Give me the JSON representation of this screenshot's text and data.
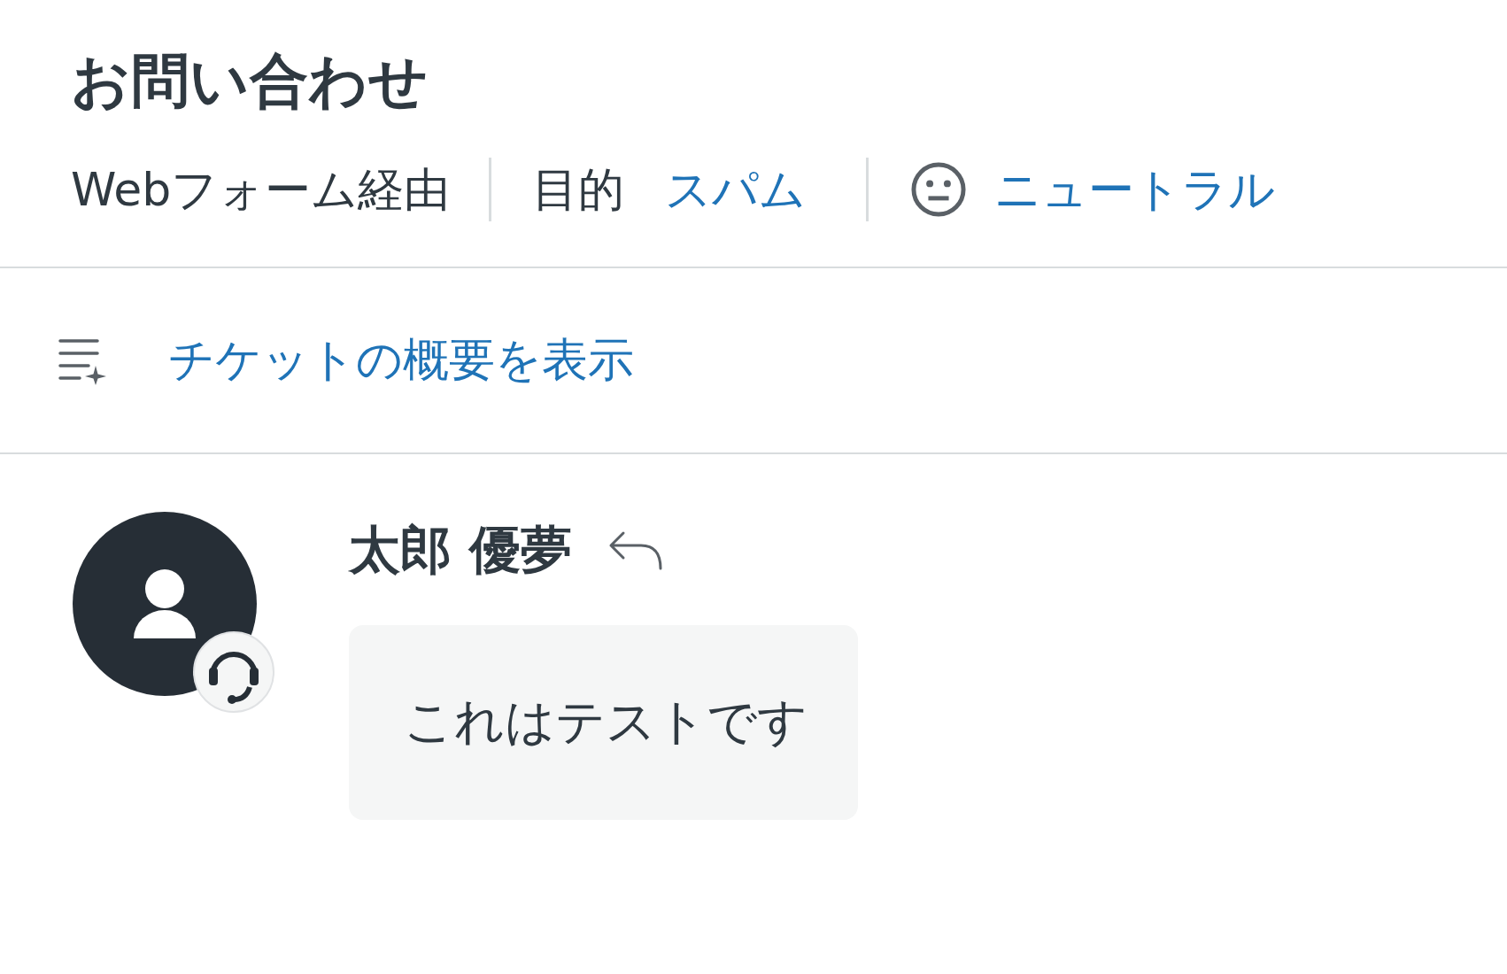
{
  "title": "お問い合わせ",
  "meta": {
    "source": "Webフォーム経由",
    "purpose_label": "目的",
    "purpose_value": "スパム",
    "sentiment": "ニュートラル"
  },
  "summary_link": "チケットの概要を表示",
  "message": {
    "author": "太郎 優夢",
    "body": "これはテストです"
  }
}
